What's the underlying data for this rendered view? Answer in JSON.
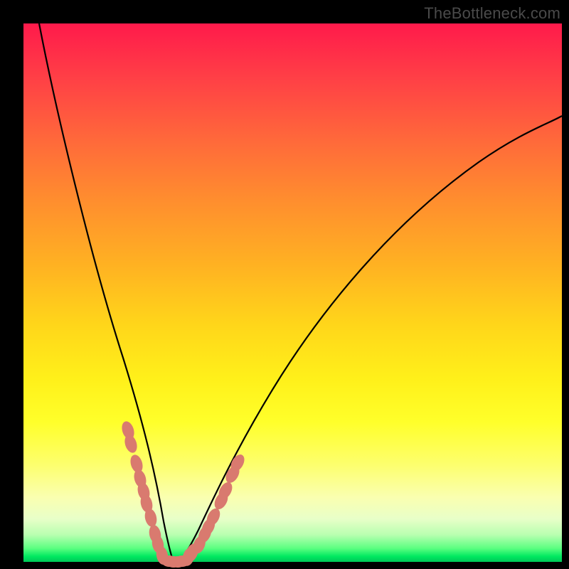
{
  "watermark": "TheBottleneck.com",
  "palette": {
    "frame": "#000000",
    "gradient_top": "#ff1a4b",
    "gradient_bottom": "#00c858",
    "curve": "#000000",
    "bead": "#d97a6f"
  },
  "chart_data": {
    "type": "line",
    "title": "",
    "xlabel": "",
    "ylabel": "",
    "xlim": [
      0,
      100
    ],
    "ylim": [
      0,
      100
    ],
    "grid": false,
    "legend": false,
    "series": [
      {
        "name": "left-branch",
        "x": [
          3,
          5,
          8,
          11,
          14,
          17,
          19.5,
          21.5,
          23,
          24.3,
          25.3,
          26.5,
          27.5
        ],
        "y": [
          100,
          88,
          72,
          58,
          45,
          33,
          23,
          15.5,
          9.5,
          5,
          2.3,
          0.6,
          0
        ]
      },
      {
        "name": "right-branch",
        "x": [
          29,
          30,
          31.5,
          33,
          35,
          37.5,
          41,
          46,
          53,
          62,
          73,
          86,
          100
        ],
        "y": [
          0,
          0.4,
          1.5,
          3.5,
          7,
          12,
          19,
          28,
          39,
          51,
          63,
          74,
          83
        ]
      }
    ],
    "annotations": {
      "beads_left": [
        [
          19.3,
          24.5
        ],
        [
          19.9,
          22
        ],
        [
          20.9,
          18.2
        ],
        [
          21.6,
          15.4
        ],
        [
          22.2,
          13
        ],
        [
          22.8,
          10.8
        ],
        [
          23.5,
          8.2
        ],
        [
          24.3,
          5.2
        ],
        [
          24.85,
          3.3
        ],
        [
          25.7,
          1.2
        ]
      ],
      "beads_bottom": [
        [
          27,
          0.15
        ],
        [
          27.8,
          0.05
        ],
        [
          28.6,
          0.05
        ],
        [
          29.4,
          0.12
        ]
      ],
      "beads_right": [
        [
          30.6,
          0.9
        ],
        [
          31.3,
          1.7
        ],
        [
          32.5,
          3.2
        ],
        [
          33.6,
          5.1
        ],
        [
          34.3,
          6.5
        ],
        [
          35.2,
          8.3
        ],
        [
          36.6,
          11.3
        ],
        [
          37.4,
          13.2
        ],
        [
          38.7,
          16.2
        ],
        [
          39.6,
          18.3
        ]
      ]
    }
  }
}
